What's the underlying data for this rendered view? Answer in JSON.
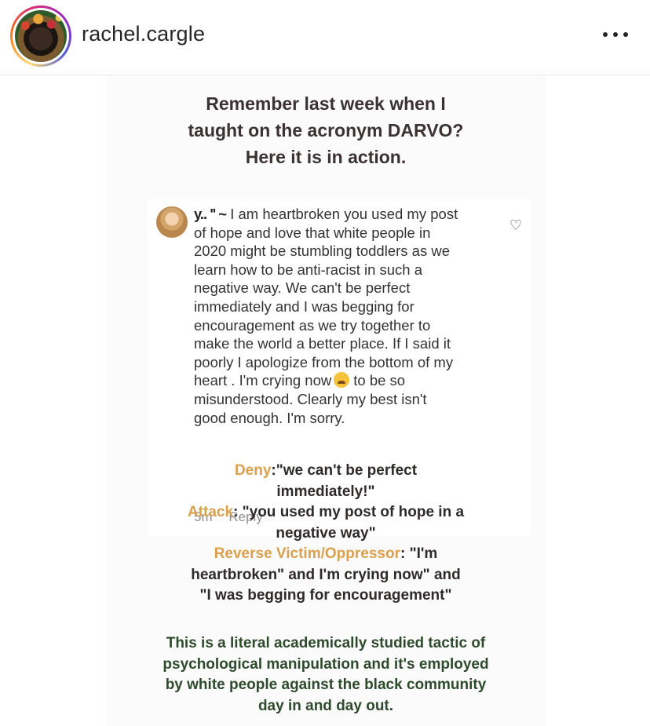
{
  "header": {
    "username": "rachel.cargle",
    "more_icon": "more-horizontal-icon"
  },
  "post": {
    "headline": [
      "Remember last week when I",
      "taught on the acronym DARVO?",
      "Here it is in action."
    ],
    "comment": {
      "user": "y.. '' ~",
      "lines": [
        "I am heartbroken you used my post",
        "of hope and love that white people in",
        "2020 might be stumbling toddlers as we",
        "learn how to be anti-racist in such a",
        "negative way.  We can't be perfect",
        "immediately and I was begging for",
        "encouragement as we try together to",
        "make the world a better place. If I said it",
        "poorly I apologize from the bottom of my",
        "heart .  I'm crying now",
        "to be so",
        "misunderstood. Clearly my best isn't",
        "good enough. I'm sorry."
      ],
      "emoji": "crying-face-emoji",
      "time": "5m",
      "reply_label": "Reply",
      "like_icon": "heart-outline-icon"
    },
    "analysis": {
      "deny_label": "Deny",
      "deny_text_1": ":\"we can't be perfect",
      "deny_text_2": "immediately!\"",
      "attack_label": "Attack",
      "attack_text_1": ": \"you used my post of hope in a",
      "attack_text_2": "negative way\"",
      "reverse_label": "Reverse Victim/Oppressor",
      "reverse_text_1": ": \"I'm",
      "reverse_text_2": "heartbroken\" and I'm crying now\" and",
      "reverse_text_3": "\"I was begging for encouragement\""
    },
    "conclusion": [
      "This is a literal academically studied tactic of",
      "psychological manipulation and it's employed",
      "by white people against the black community",
      "day in and day out."
    ]
  },
  "colors": {
    "label_accent": "#d9a04d",
    "conclusion_green": "#2e4a2c"
  }
}
